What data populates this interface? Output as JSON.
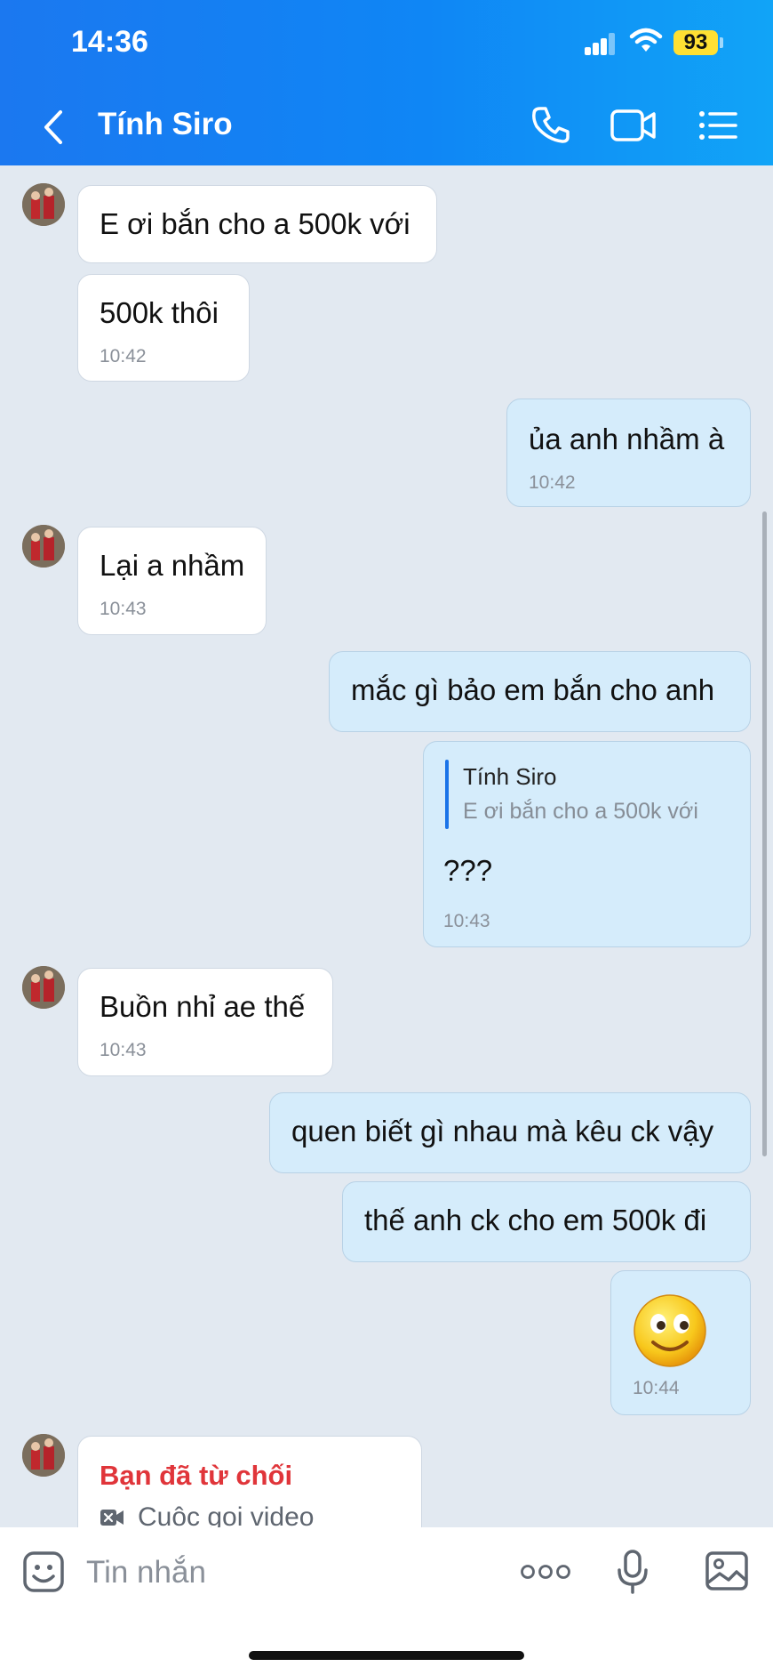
{
  "status_bar": {
    "time": "14:36",
    "battery": "93"
  },
  "header": {
    "title": "Tính Siro"
  },
  "messages": [
    {
      "text": "E ơi bắn cho a 500k với"
    },
    {
      "text": "500k thôi",
      "time": "10:42"
    },
    {
      "text": "ủa anh nhầm à",
      "time": "10:42"
    },
    {
      "text": "Lại a nhầm",
      "time": "10:43"
    },
    {
      "text": "mắc gì bảo em bắn cho anh"
    },
    {
      "quote_author": "Tính Siro",
      "quote_text": "E ơi bắn cho a 500k với",
      "text": "???",
      "time": "10:43"
    },
    {
      "text": "Buồn nhỉ ae thế",
      "time": "10:43"
    },
    {
      "text": "quen biết gì nhau mà kêu ck vậy"
    },
    {
      "text": "thế anh ck cho em 500k đi"
    },
    {
      "time": "10:44"
    },
    {
      "call_status": "Bạn đã từ chối",
      "call_type": "Cuộc gọi video"
    }
  ],
  "input": {
    "placeholder": "Tin nhắn"
  },
  "colors": {
    "header_start": "#1b78f0",
    "header_end": "#11a4f7",
    "incoming_bubble": "#ffffff",
    "outgoing_bubble": "#d5ecfb",
    "declined_call": "#e0353a",
    "battery": "#ffe033"
  },
  "icons": [
    "back-arrow-icon",
    "phone-icon",
    "video-camera-icon",
    "menu-list-icon",
    "sticker-icon",
    "more-dots-icon",
    "microphone-icon",
    "image-gallery-icon",
    "smiley-emoji-icon",
    "video-call-declined-icon"
  ]
}
